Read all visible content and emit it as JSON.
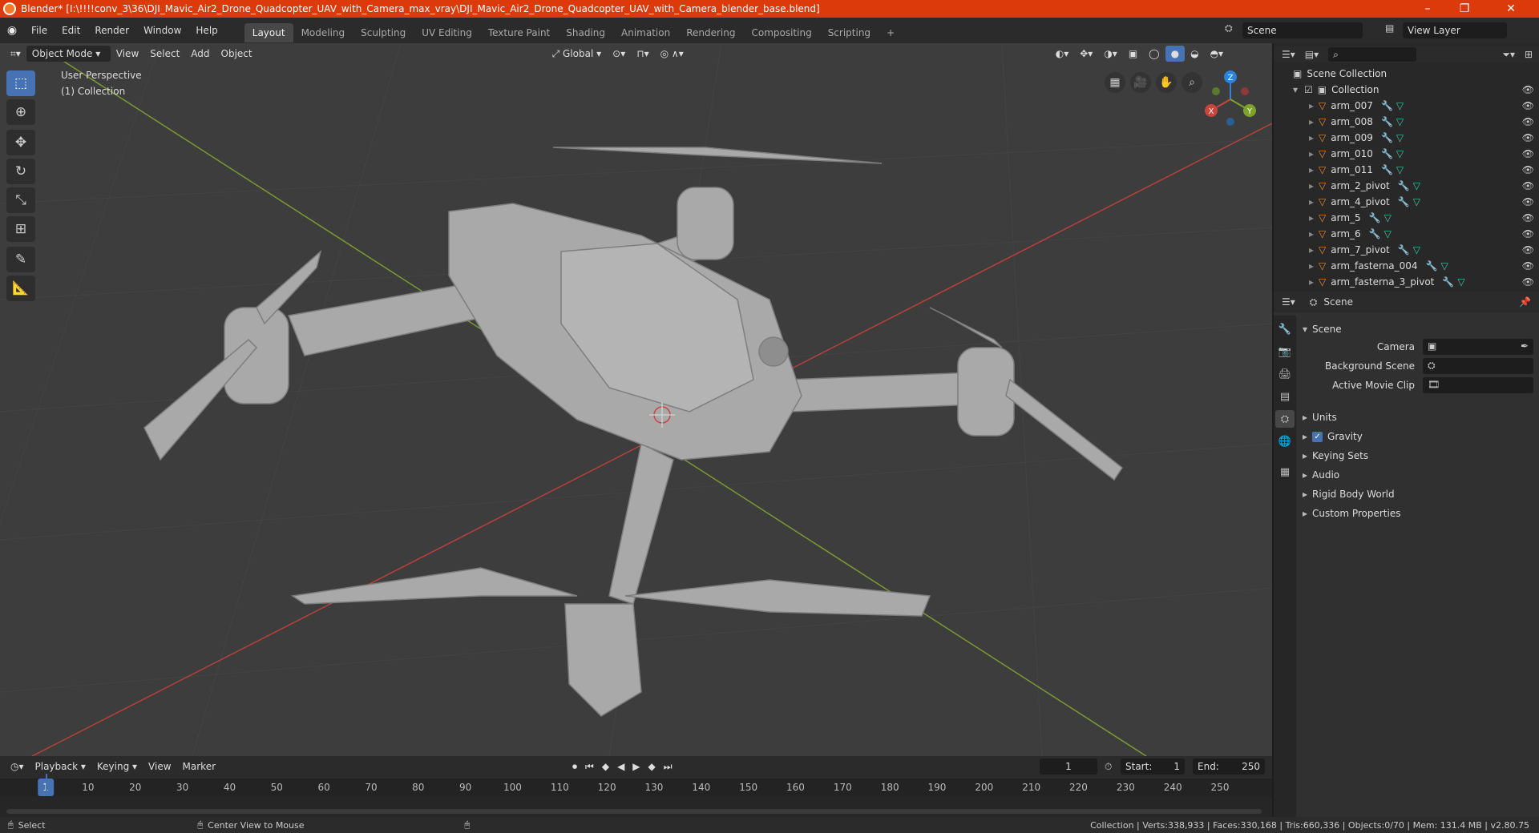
{
  "window": {
    "title": "Blender* [I:\\!!!!conv_3\\36\\DJI_Mavic_Air2_Drone_Quadcopter_UAV_with_Camera_max_vray\\DJI_Mavic_Air2_Drone_Quadcopter_UAV_with_Camera_blender_base.blend]",
    "minimize": "–",
    "maximize": "❐",
    "close": "✕"
  },
  "menu": [
    "File",
    "Edit",
    "Render",
    "Window",
    "Help"
  ],
  "workspaces": [
    "Layout",
    "Modeling",
    "Sculpting",
    "UV Editing",
    "Texture Paint",
    "Shading",
    "Animation",
    "Rendering",
    "Compositing",
    "Scripting"
  ],
  "workspace_add": "+",
  "scene_field": "Scene",
  "view_layer_field": "View Layer",
  "viewport": {
    "mode": "Object Mode",
    "menus": [
      "View",
      "Select",
      "Add",
      "Object"
    ],
    "transform_orientation": "Global",
    "perspective": "User Perspective",
    "collection": "(1) Collection",
    "gizmo": {
      "x": "X",
      "y": "Y",
      "z": "Z"
    }
  },
  "outliner": {
    "search_placeholder": "",
    "root": "Scene Collection",
    "collection": "Collection",
    "items": [
      "arm_007",
      "arm_008",
      "arm_009",
      "arm_010",
      "arm_011",
      "arm_2_pivot",
      "arm_4_pivot",
      "arm_5",
      "arm_6",
      "arm_7_pivot",
      "arm_fasterna_004",
      "arm_fasterna_3_pivot"
    ]
  },
  "properties": {
    "context": "Scene",
    "section": "Scene",
    "camera_label": "Camera",
    "background_scene_label": "Background Scene",
    "active_movie_clip_label": "Active Movie Clip",
    "panels": [
      "Units",
      "Gravity",
      "Keying Sets",
      "Audio",
      "Rigid Body World",
      "Custom Properties"
    ]
  },
  "timeline": {
    "menus": [
      "Playback",
      "Keying",
      "View",
      "Marker"
    ],
    "current_frame": "1",
    "start_label": "Start:",
    "start": "1",
    "end_label": "End:",
    "end": "250",
    "ticks": [
      "1",
      "10",
      "20",
      "30",
      "40",
      "50",
      "60",
      "70",
      "80",
      "90",
      "100",
      "110",
      "120",
      "130",
      "140",
      "150",
      "160",
      "170",
      "180",
      "190",
      "200",
      "210",
      "220",
      "230",
      "240",
      "250"
    ]
  },
  "status": {
    "left": "Select",
    "middle": "Center View to Mouse",
    "right": "Collection | Verts:338,933 | Faces:330,168 | Tris:660,336 | Objects:0/70 | Mem: 131.4 MB | v2.80.75"
  },
  "colors": {
    "accent": "#4772b3",
    "title": "#dd3a0b",
    "x_axis": "#c9453e",
    "y_axis": "#7da32a",
    "z_axis": "#2f82d8"
  }
}
